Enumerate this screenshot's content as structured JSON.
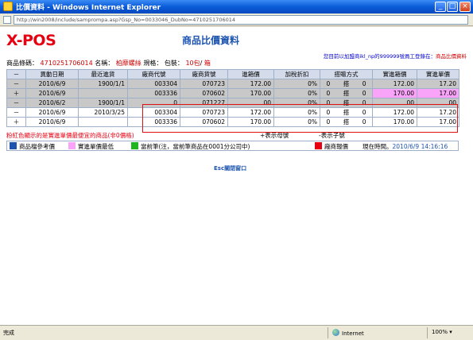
{
  "window": {
    "title": "比價資料 - Windows Internet Explorer",
    "address": "http://win2008/include/samprompa.asp?Gsp_No=0033046_DubNo=4710251706014"
  },
  "app": {
    "logo": "X-POS",
    "page_title": "商品比價資料"
  },
  "notice": {
    "prefix": "您目前以加盟商ikl_np的999999號員工登錄在：",
    "location": "商品比價資料"
  },
  "product": {
    "barcode_label": "商品條碼：",
    "barcode": "4710251706014",
    "name_label": "名稱：",
    "name": "柏靡螺絲",
    "spec_label": "規格：",
    "pack_label": "包裝：",
    "pack_qty": "10包",
    "pack_sep": "/",
    "pack_unit": "箱"
  },
  "table": {
    "headers": [
      "－",
      "異動日期",
      "最近進貨",
      "廠商代號",
      "廠商貨號",
      "進箱價",
      "加稅折扣",
      "搭贈方式",
      "實進箱價",
      "實進單價"
    ],
    "rows": [
      {
        "sym": "－",
        "date": "2010/6/9",
        "recent": "1900/1/1",
        "vendor": "003304",
        "vitem": "070723",
        "box": "172.00",
        "tax": "0%",
        "gift1": "0",
        "gift2": "搭",
        "gift3": "0",
        "rbox": "172.00",
        "runit": "17.20",
        "hl": true,
        "pink": false
      },
      {
        "sym": "＋",
        "date": "2010/6/9",
        "recent": "",
        "vendor": "003336",
        "vitem": "070602",
        "box": "170.00",
        "tax": "0%",
        "gift1": "0",
        "gift2": "搭",
        "gift3": "0",
        "rbox": "170.00",
        "runit": "17.00",
        "hl": true,
        "pink": true
      },
      {
        "sym": "－",
        "date": "2010/6/2",
        "recent": "1900/1/1",
        "vendor": "0",
        "vitem": "071227",
        "box": ".00",
        "tax": "0%",
        "gift1": "0",
        "gift2": "搭",
        "gift3": "0",
        "rbox": ".00",
        "runit": ".00",
        "hl": true,
        "pink": false
      },
      {
        "sym": "－",
        "date": "2010/6/9",
        "recent": "2010/3/25",
        "vendor": "003304",
        "vitem": "070723",
        "box": "172.00",
        "tax": "0%",
        "gift1": "0",
        "gift2": "搭",
        "gift3": "0",
        "rbox": "172.00",
        "runit": "17.20",
        "hl": false,
        "pink": false
      },
      {
        "sym": "＋",
        "date": "2010/6/9",
        "recent": "",
        "vendor": "003336",
        "vitem": "070602",
        "box": "170.00",
        "tax": "0%",
        "gift1": "0",
        "gift2": "搭",
        "gift3": "0",
        "rbox": "170.00",
        "runit": "17.00",
        "hl": false,
        "pink": false
      }
    ]
  },
  "notes": {
    "pink_note": "粉紅色顯示的是實進單價最便宜的商品(非0價格)",
    "plus_note": "+表示母號",
    "minus_note": "-表示子號"
  },
  "legend": {
    "ref": "商品檔參考價",
    "cheapest": "實進單價最低",
    "current": "當前筆(注，當前筆商品在0001分公司中)",
    "vendor_quote": "廠商報價",
    "time_label": "現在時間。",
    "time": "2010/6/9 14:16:16",
    "colors": {
      "ref": "#1C54B0",
      "cheapest": "#F9A3F9",
      "current": "#1FB51F",
      "vendor_quote": "#E60012"
    }
  },
  "esc": "Esc關閉窗口",
  "status": {
    "text": "完成",
    "zone": "Internet",
    "zoom": "100%"
  }
}
